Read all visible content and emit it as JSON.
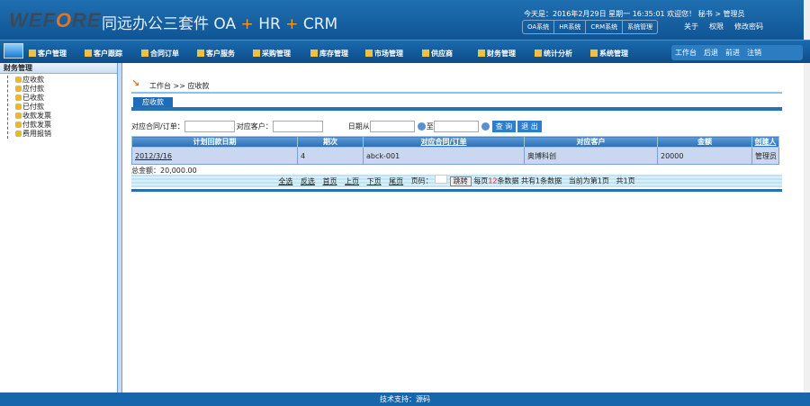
{
  "header": {
    "logo_pre": "WEF",
    "logo_o": "O",
    "logo_post": "RE",
    "title": "同远办公三套件 OA",
    "plus1": "+",
    "hr": "HR",
    "plus2": "+",
    "crm": "CRM",
    "date": "今天是：2016年2月29日  星期一  16:35:01  欢迎您！ 秘书 > 管理员",
    "systabs": [
      "OA系统",
      "HR系统",
      "CRM系统",
      "系统管理"
    ],
    "links": [
      "关于",
      "权限",
      "修改密码"
    ]
  },
  "nav": {
    "items": [
      "客户管理",
      "客户跟踪",
      "合同订单",
      "客户服务",
      "采购管理",
      "库存管理",
      "市场管理",
      "供应商",
      "财务管理",
      "统计分析",
      "系统管理"
    ],
    "right": [
      "工作台",
      "后退",
      "前进",
      "注销"
    ]
  },
  "sidebar": {
    "title": "财务管理",
    "items": [
      "应收款",
      "应付款",
      "已收款",
      "已付款",
      "收款发票",
      "付款发票",
      "费用报销"
    ]
  },
  "main": {
    "breadcrumb": "工作台 >> 应收款",
    "tab": "应收款",
    "filter": {
      "contract_label": "对应合同/订单：",
      "customer_label": "对应客户：",
      "date_from_label": "日期从",
      "to_label": "至",
      "query": "查 询",
      "exit": "退 出"
    },
    "table": {
      "headers": [
        "计划回款日期",
        "期次",
        "对应合同/订单",
        "对应客户",
        "金额",
        "创建人"
      ],
      "rows": [
        [
          "2012/3/16",
          "4",
          "abck-001",
          "奥博科创",
          "20000",
          "管理员"
        ]
      ]
    },
    "total": "总金额：20,000.00",
    "pager": {
      "links": [
        "全选",
        "反选",
        "首页",
        "上页",
        "下页",
        "尾页"
      ],
      "page_label": "页码：",
      "go": "跳转",
      "per_page_pre": "每页",
      "per_page": "12",
      "per_page_post": "条数据",
      "total": "共有1条数据",
      "current": "当前为第1页",
      "pages": "共1页"
    }
  },
  "footer": "技术支持：源码",
  "colors": {
    "brand": "#0f5596",
    "accent": "#e8731a"
  }
}
